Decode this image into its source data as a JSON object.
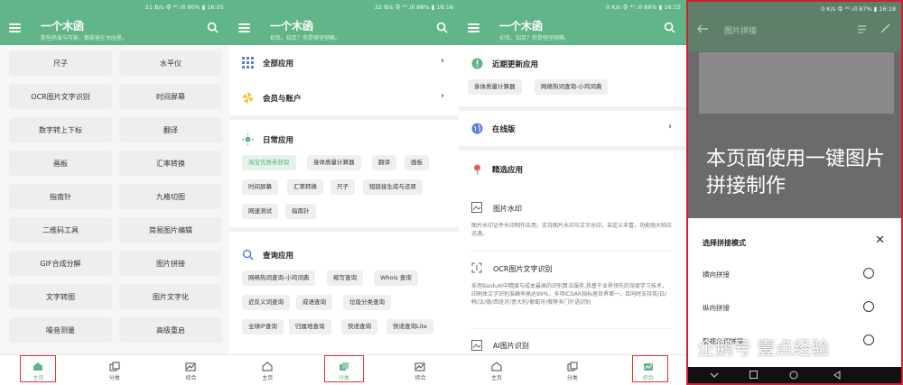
{
  "panels": {
    "home": {
      "status": "21 B/s 令 ⁴ᴳ.ıll 90% ▮ 16:05",
      "title": "一个木函",
      "subtitle": "那些热爱与可能，都能留在木函里。",
      "buttons": [
        "尺子",
        "水平仪",
        "OCR图片文字识别",
        "时间屏幕",
        "数字转上下标",
        "翻译",
        "画板",
        "汇率转换",
        "指南针",
        "九格切图",
        "二维码工具",
        "简易图片编辑",
        "GIF合成分解",
        "图片拼接",
        "文字转图",
        "图片文字化",
        "噪音测量",
        "高级重启"
      ]
    },
    "category": {
      "status": "32 B/s 令 ⁴ᴳ.ıll 88% ▮ 16:16",
      "title": "一个木函",
      "subtitle": "初页。知足？你是够坚韧嘛。",
      "all_apps": "全部应用",
      "member": "会员与账户",
      "daily": "日常应用",
      "daily_chips": [
        "淘宝优惠券获取",
        "身体质量计算器",
        "翻译",
        "画板",
        "时间屏幕",
        "汇率转换",
        "尺子",
        "短链接生成与还原",
        "网速测试",
        "指南针"
      ],
      "query": "查询应用",
      "query_chips": [
        "网络热词查询-小鸡词典",
        "缩写查询",
        "Whois 查询",
        "近反义词查询",
        "成语查询",
        "垃圾分类查询",
        "全球IP查询",
        "归属地查询",
        "快递查询",
        "快递查询Lite"
      ]
    },
    "misc": {
      "status": "0 K/s 令 ⁴ᴳ.ıll 88% ▮ 16:15",
      "title": "一个木函",
      "subtitle": "初页。知足？你是够坚韧嘛。",
      "recent": "近期更新应用",
      "recent_chips": [
        "身体质量计算器",
        "网络热词查询-小鸡词典"
      ],
      "online": "在线版",
      "featured": "精选应用",
      "watermark_title": "图片水印",
      "watermark_desc": "图片水印证件水印制作应用，支持图片水印与文字水印，自定义丰富，功能强大响应迅速。",
      "ocr_title": "OCR图片文字识别",
      "ocr_desc": "采用BaiduAI中精度与成本最高的识别算法服务,其基于业界领先的深度学习技术，印刷体文字识别准确率高达99%，多项ICDAR指标居世界第一，且同时支持英/日/韩/法/德/西班牙/意大利/葡萄牙/俄等多门外语识别",
      "ai_title": "AI图片识别"
    },
    "stitch": {
      "status": "0 K/s 令 ⁴ᴳ.ıll 87% ▮ 16:18",
      "title": "图片拼接",
      "overlay": "本页面使用一键图片拼接制作",
      "sheet_title": "选择拼接模式",
      "options": [
        "横向拼接",
        "纵向拼接",
        "影视台词拼接"
      ],
      "watermark": "企鹅号 壹点经验"
    }
  },
  "nav": [
    "主页",
    "分类",
    "综合"
  ],
  "colors": {
    "accent": "#62b588",
    "highlight_box": "#d33333"
  }
}
